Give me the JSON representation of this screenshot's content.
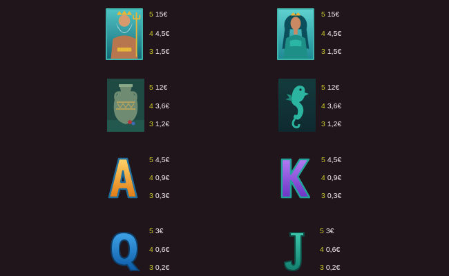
{
  "colors": {
    "background": "#21151c",
    "count": "#c9c82a",
    "value": "#f2eef0",
    "tile_border": "#3fb6ad"
  },
  "symbols": [
    {
      "id": "poseidon",
      "icon": "poseidon-icon",
      "pays": [
        {
          "count": "5",
          "value": "15€"
        },
        {
          "count": "4",
          "value": "4,5€"
        },
        {
          "count": "3",
          "value": "1,5€"
        }
      ]
    },
    {
      "id": "mermaid",
      "icon": "mermaid-queen-icon",
      "pays": [
        {
          "count": "5",
          "value": "15€"
        },
        {
          "count": "4",
          "value": "4,5€"
        },
        {
          "count": "3",
          "value": "1,5€"
        }
      ]
    },
    {
      "id": "amphora",
      "icon": "amphora-icon",
      "pays": [
        {
          "count": "5",
          "value": "12€"
        },
        {
          "count": "4",
          "value": "3,6€"
        },
        {
          "count": "3",
          "value": "1,2€"
        }
      ]
    },
    {
      "id": "seahorse",
      "icon": "seahorse-icon",
      "pays": [
        {
          "count": "5",
          "value": "12€"
        },
        {
          "count": "4",
          "value": "3,6€"
        },
        {
          "count": "3",
          "value": "1,2€"
        }
      ]
    },
    {
      "id": "letter_a",
      "icon": "letter-a-icon",
      "pays": [
        {
          "count": "5",
          "value": "4,5€"
        },
        {
          "count": "4",
          "value": "0,9€"
        },
        {
          "count": "3",
          "value": "0,3€"
        }
      ]
    },
    {
      "id": "letter_k",
      "icon": "letter-k-icon",
      "pays": [
        {
          "count": "5",
          "value": "4,5€"
        },
        {
          "count": "4",
          "value": "0,9€"
        },
        {
          "count": "3",
          "value": "0,3€"
        }
      ]
    },
    {
      "id": "letter_q",
      "icon": "letter-q-icon",
      "pays": [
        {
          "count": "5",
          "value": "3€"
        },
        {
          "count": "4",
          "value": "0,6€"
        },
        {
          "count": "3",
          "value": "0,2€"
        }
      ]
    },
    {
      "id": "letter_j",
      "icon": "letter-j-icon",
      "pays": [
        {
          "count": "5",
          "value": "3€"
        },
        {
          "count": "4",
          "value": "0,6€"
        },
        {
          "count": "3",
          "value": "0,2€"
        }
      ]
    }
  ]
}
